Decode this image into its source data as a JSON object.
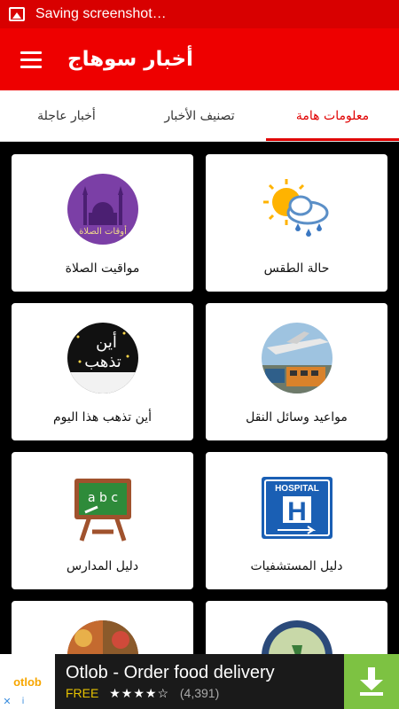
{
  "status_bar": {
    "text": "Saving screenshot…"
  },
  "app_bar": {
    "title": "أخبار سوهاج"
  },
  "tabs": [
    {
      "label": "أخبار عاجلة",
      "active": false
    },
    {
      "label": "تصنيف الأخبار",
      "active": false
    },
    {
      "label": "معلومات هامة",
      "active": true
    }
  ],
  "grid": {
    "items": [
      {
        "label": "حالة الطقس",
        "icon": "weather-icon"
      },
      {
        "label": "مواقيت الصلاة",
        "icon": "mosque-icon"
      },
      {
        "label": "مواعيد وسائل النقل",
        "icon": "transport-icon"
      },
      {
        "label": "أين تذهب هذا اليوم",
        "icon": "where-to-go-icon"
      },
      {
        "label": "دليل المستشفيات",
        "icon": "hospital-icon"
      },
      {
        "label": "دليل المدارس",
        "icon": "school-board-icon"
      },
      {
        "label": "",
        "icon": "food-icon"
      },
      {
        "label": "",
        "icon": "badge-icon"
      }
    ],
    "mosque_text": "أوقات الصلاة",
    "hospital_sign": "HOSPITAL",
    "hospital_letter": "H",
    "board_text": "a b c",
    "where_text_1": "أين",
    "where_text_2": "تذهب"
  },
  "ad": {
    "logo": "otlob",
    "title": "Otlob - Order food delivery",
    "free": "FREE",
    "stars": "★★★★☆",
    "count": "(4,391)",
    "close": "✕",
    "info": "i"
  },
  "colors": {
    "primary": "#ee0000",
    "status": "#d80000",
    "tab_active": "#e00000",
    "download": "#7dc242"
  }
}
